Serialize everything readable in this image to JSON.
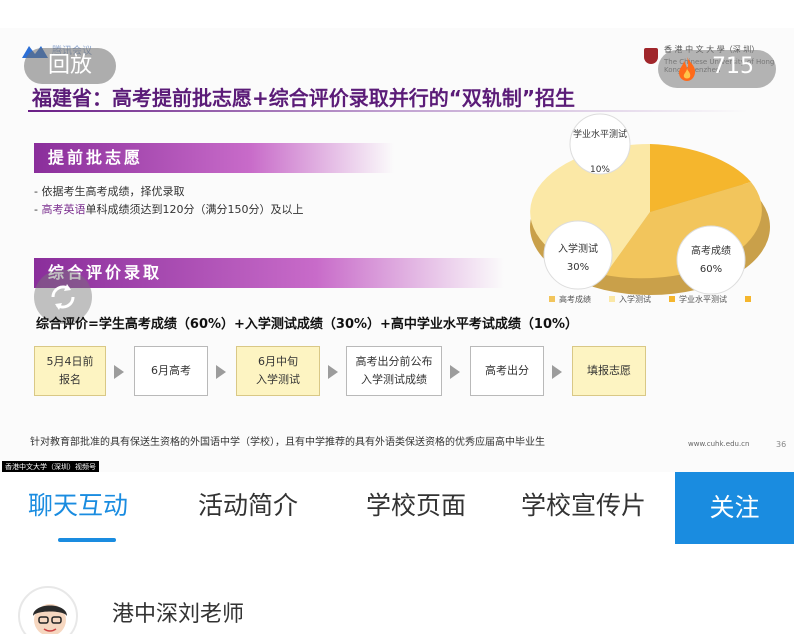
{
  "player": {
    "replay_label": "回放",
    "viewers": "715",
    "logo_text": "腾讯会议",
    "channel_tag": "香港中文大学（深圳）视频号"
  },
  "slide": {
    "title": "福建省：高考提前批志愿+综合评价录取并行的“双轨制”招生",
    "university_cn": "香 港 中 文 大 學（深 圳）",
    "university_en": "The Chinese University of Hong Kong, Shenzhen",
    "section1_title": "提前批志愿",
    "bullet1": "依据考生高考成绩，择优录取",
    "bullet2_hl": "高考英语",
    "bullet2_rest": "单科成绩须达到120分（满分150分）及以上",
    "section2_title": "综合评价录取",
    "formula": "综合评价=学生高考成绩（60%）+入学测试成绩（30%）+高中学业水平考试成绩（10%）",
    "steps": [
      {
        "line1": "5月4日前",
        "line2": "报名"
      },
      {
        "line1": "6月高考",
        "line2": ""
      },
      {
        "line1": "6月中旬",
        "line2": "入学测试"
      },
      {
        "line1": "高考出分前公布",
        "line2": "入学测试成绩"
      },
      {
        "line1": "高考出分",
        "line2": ""
      },
      {
        "line1": "填报志愿",
        "line2": ""
      }
    ],
    "footnote": "针对教育部批准的具有保送生资格的外国语中学（学校），且有中学推荐的具有外语类保送资格的优秀应届高中毕业生",
    "url": "www.cuhk.edu.cn",
    "page_number": "36",
    "pie": {
      "slices": [
        {
          "label": "高考成绩",
          "value": "60%",
          "color": "#f2c55c"
        },
        {
          "label": "入学测试",
          "value": "30%",
          "color": "#fbe8a6"
        },
        {
          "label": "学业水平测试",
          "value": "10%",
          "color": "#f5b62d"
        }
      ],
      "legend": [
        "高考成绩",
        "入学测试",
        "学业水平测试"
      ]
    }
  },
  "tabs": [
    "聊天互动",
    "活动简介",
    "学校页面",
    "学校宣传片"
  ],
  "follow_label": "关注",
  "chat": {
    "username": "港中深刘老师"
  }
}
